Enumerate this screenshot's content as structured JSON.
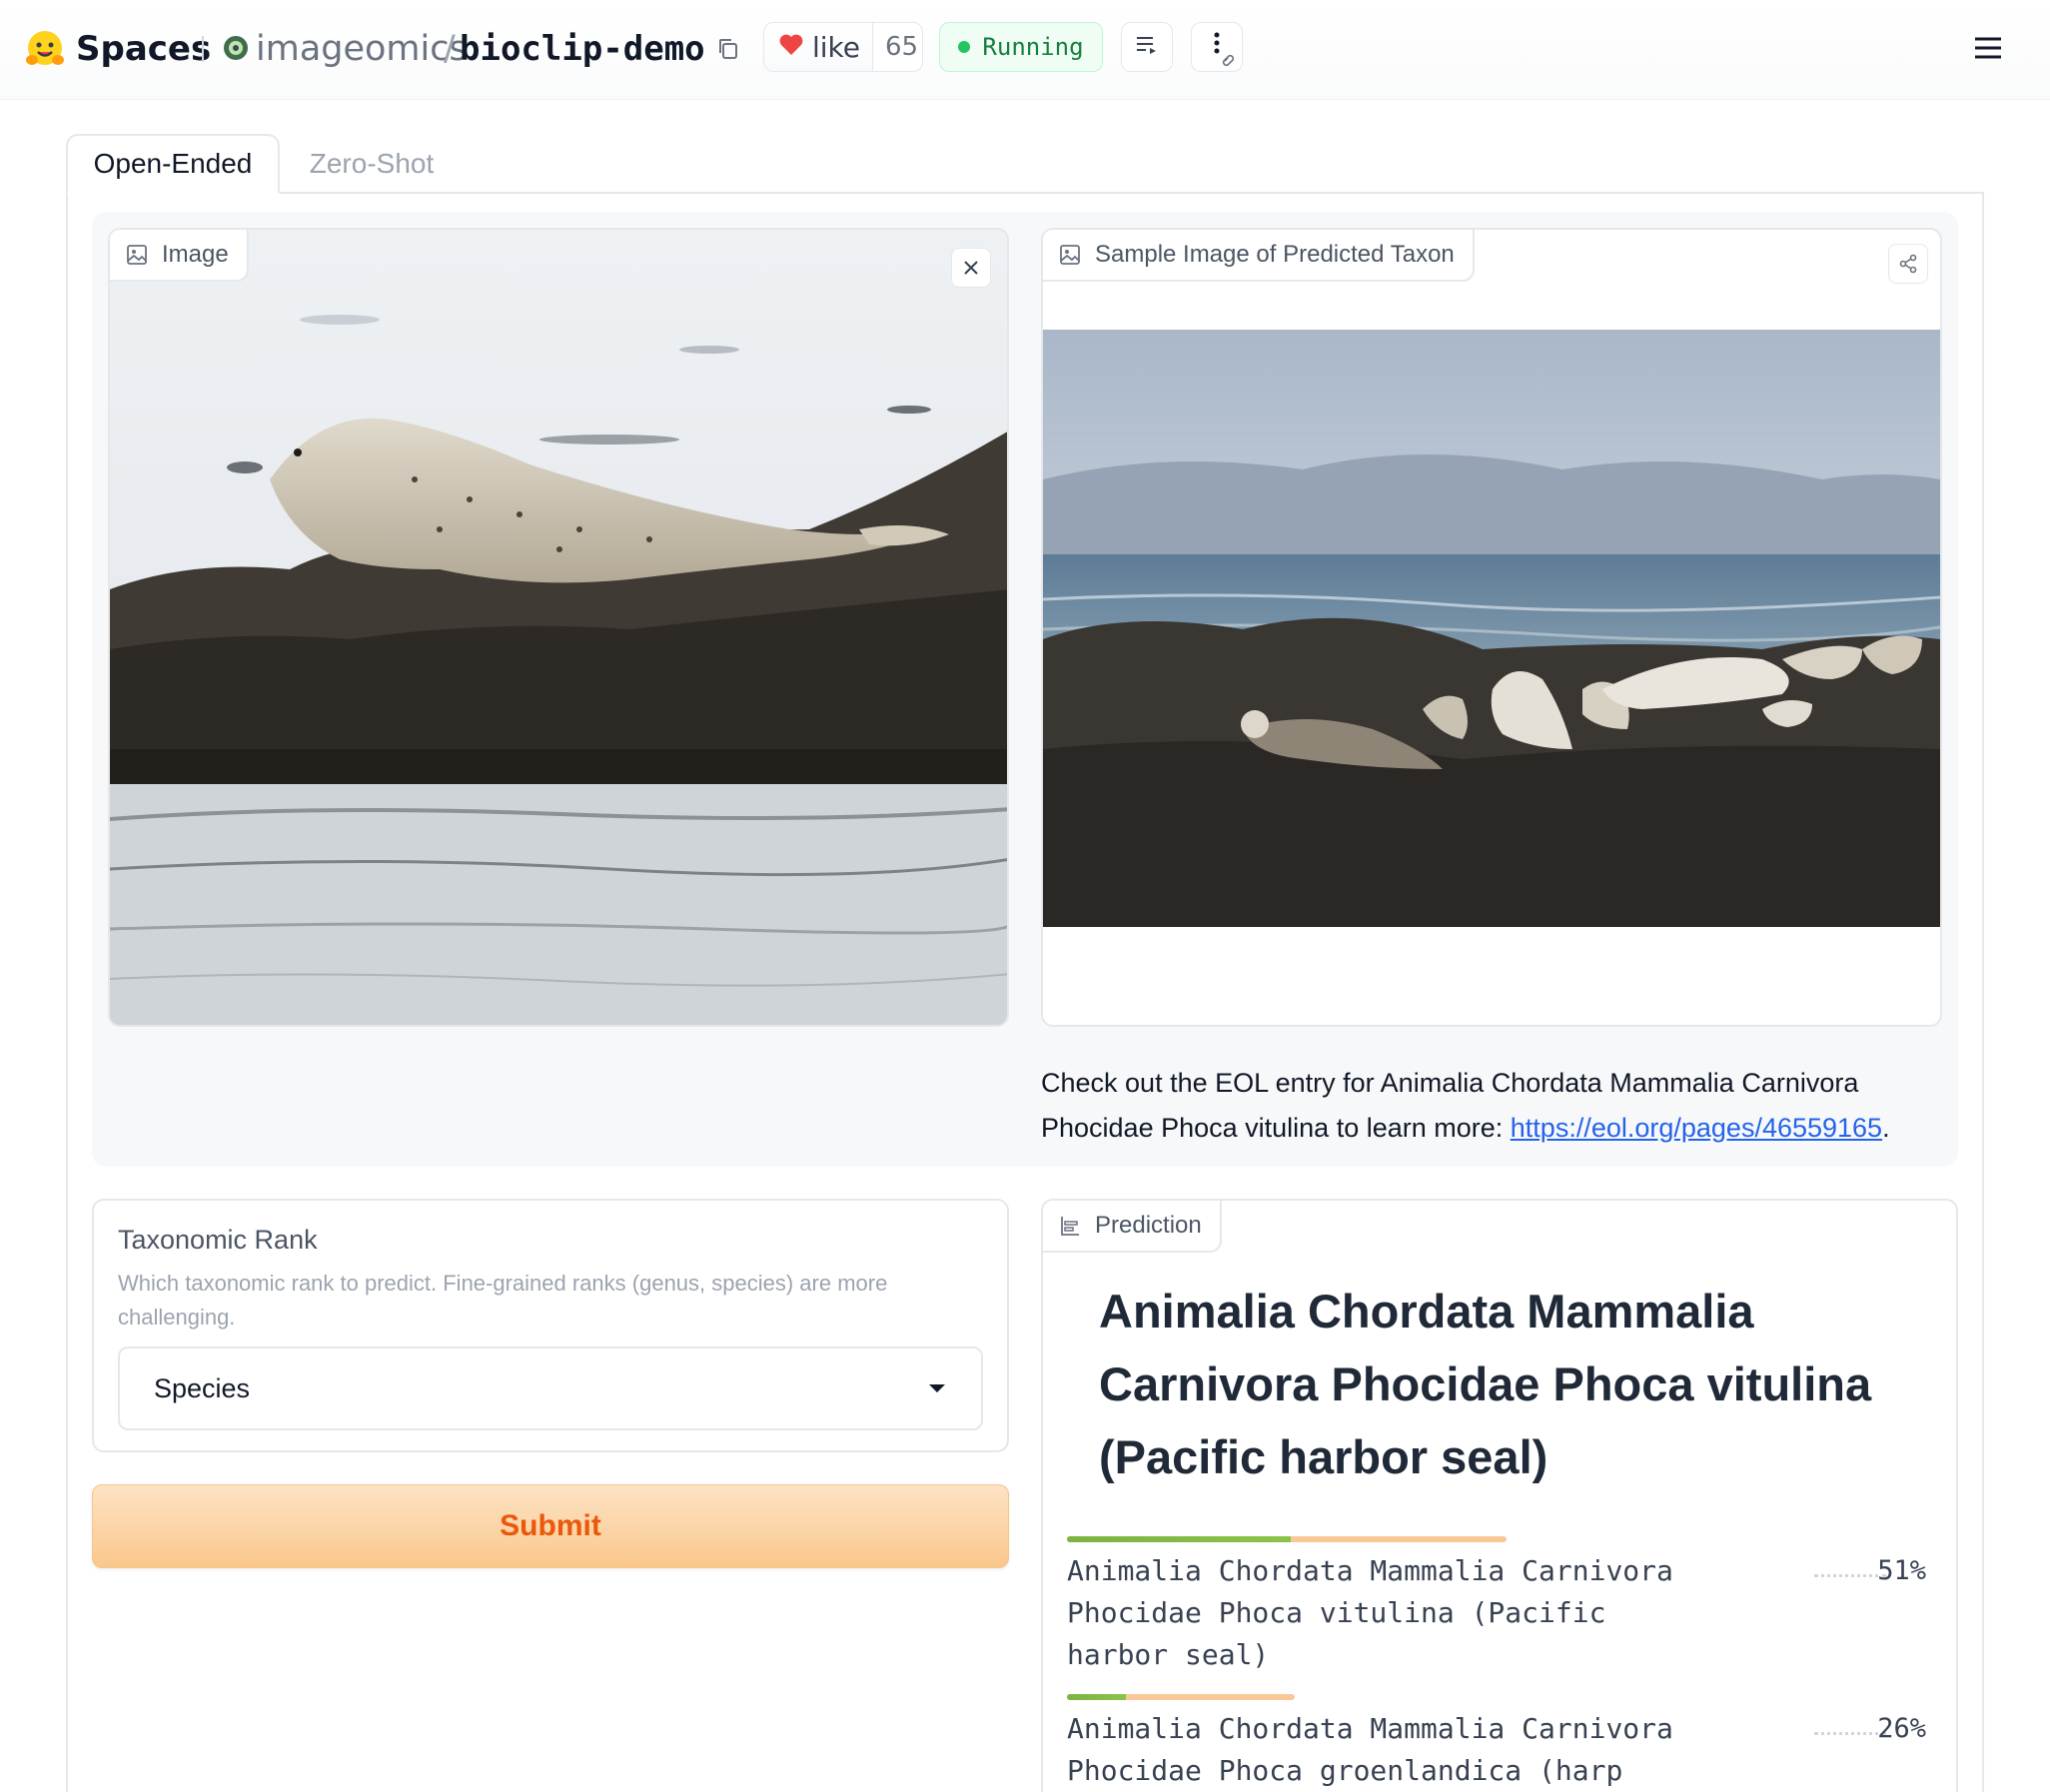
{
  "header": {
    "spaces_label": "Spaces",
    "org": "imageomics",
    "separator": "/",
    "repo": "bioclip-demo",
    "like_label": "like",
    "like_count": "65",
    "status": "Running",
    "colors": {
      "status_bg": "#f0fdf4",
      "status_text": "#15803d",
      "heart": "#ef4444"
    }
  },
  "tabs": [
    {
      "label": "Open-Ended",
      "active": true
    },
    {
      "label": "Zero-Shot",
      "active": false
    }
  ],
  "input_image": {
    "label": "Image",
    "icon": "image-icon"
  },
  "output_image": {
    "label": "Sample Image of Predicted Taxon",
    "icon": "image-icon"
  },
  "eol": {
    "text_before": "Check out the EOL entry for Animalia Chordata Mammalia Carnivora Phocidae Phoca vitulina to learn more: ",
    "link": "https://eol.org/pages/46559165",
    "text_after": "."
  },
  "rank": {
    "title": "Taxonomic Rank",
    "description": "Which taxonomic rank to predict. Fine-grained ranks (genus, species) are more challenging.",
    "value": "Species"
  },
  "submit_label": "Submit",
  "prediction": {
    "label": "Prediction",
    "title": "Animalia Chordata Mammalia Carnivora Phocidae Phoca vitulina (Pacific harbor seal)",
    "confidences": [
      {
        "label": "Animalia Chordata Mammalia Carnivora Phocidae Phoca vitulina (Pacific harbor seal)",
        "percent": "51%",
        "value": 0.51
      },
      {
        "label": "Animalia Chordata Mammalia Carnivora Phocidae Phoca groenlandica (harp seal)",
        "percent": "26%",
        "value": 0.26
      }
    ]
  },
  "accent_colors": {
    "submit_text": "#ea580c",
    "bar_orange": "#f9c896",
    "bar_green": "#8bc34a",
    "link": "#2563eb"
  }
}
